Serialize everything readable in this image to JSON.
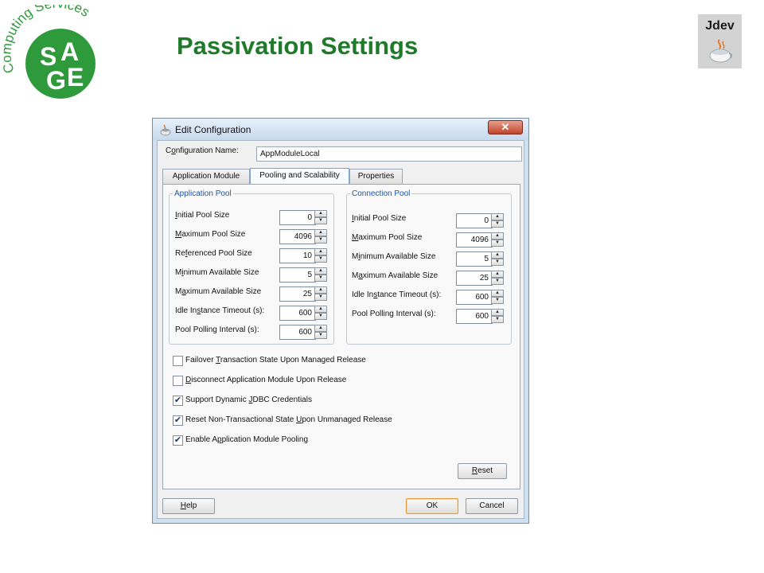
{
  "slide": {
    "title": "Passivation Settings",
    "logo": {
      "ring_text": "Computing Services",
      "letters": [
        "S",
        "A",
        "G",
        "E"
      ],
      "color": "#2e9a3c"
    },
    "badge": {
      "label": "Jdev"
    }
  },
  "dialog": {
    "title": "Edit Configuration",
    "close_label": "✕",
    "config_name": {
      "label_pre": "C",
      "label_u": "o",
      "label_post": "nfiguration Name:",
      "value": "AppModuleLocal"
    },
    "tabs": [
      {
        "label": "Application Module",
        "active": false
      },
      {
        "label": "Pooling and Scalability",
        "active": true
      },
      {
        "label": "Properties",
        "active": false
      }
    ],
    "application_pool": {
      "legend": "Application Pool",
      "fields": [
        {
          "pre": "",
          "u": "I",
          "post": "nitial Pool Size",
          "value": "0"
        },
        {
          "pre": "",
          "u": "M",
          "post": "aximum Pool Size",
          "value": "4096"
        },
        {
          "pre": "Re",
          "u": "f",
          "post": "erenced Pool Size",
          "value": "10"
        },
        {
          "pre": "M",
          "u": "i",
          "post": "nimum Available Size",
          "value": "5"
        },
        {
          "pre": "M",
          "u": "a",
          "post": "ximum Available Size",
          "value": "25"
        },
        {
          "pre": "Idle In",
          "u": "s",
          "post": "tance Timeout (s):",
          "value": "600"
        },
        {
          "pre": "Pool Polling Interval (s):",
          "u": "",
          "post": "",
          "value": "600"
        }
      ]
    },
    "connection_pool": {
      "legend": "Connection Pool",
      "fields": [
        {
          "pre": "",
          "u": "I",
          "post": "nitial Pool Size",
          "value": "0"
        },
        {
          "pre": "",
          "u": "M",
          "post": "aximum Pool Size",
          "value": "4096"
        },
        {
          "pre": "M",
          "u": "i",
          "post": "nimum Available Size",
          "value": "5"
        },
        {
          "pre": "M",
          "u": "a",
          "post": "ximum Available Size",
          "value": "25"
        },
        {
          "pre": "Idle In",
          "u": "s",
          "post": "tance Timeout (s):",
          "value": "600"
        },
        {
          "pre": "Pool Polling Interval (s):",
          "u": "",
          "post": "",
          "value": "600"
        }
      ]
    },
    "checkboxes": [
      {
        "pre": "Failover ",
        "u": "T",
        "post": "ransaction State Upon Managed Release",
        "checked": false
      },
      {
        "pre": "",
        "u": "D",
        "post": "isconnect Application Module Upon Release",
        "checked": false
      },
      {
        "pre": "Support Dynamic ",
        "u": "J",
        "post": "DBC Credentials",
        "checked": true
      },
      {
        "pre": "Reset Non-Transactional State ",
        "u": "U",
        "post": "pon Unmanaged Release",
        "checked": true
      },
      {
        "pre": "Enable A",
        "u": "p",
        "post": "plication Module Pooling",
        "checked": true
      }
    ],
    "buttons": {
      "reset": {
        "u": "R",
        "post": "eset"
      },
      "help": {
        "u": "H",
        "post": "elp"
      },
      "ok": "OK",
      "cancel": "Cancel"
    },
    "check_glyph": "✔",
    "spin_up": "▲",
    "spin_down": "▼"
  }
}
